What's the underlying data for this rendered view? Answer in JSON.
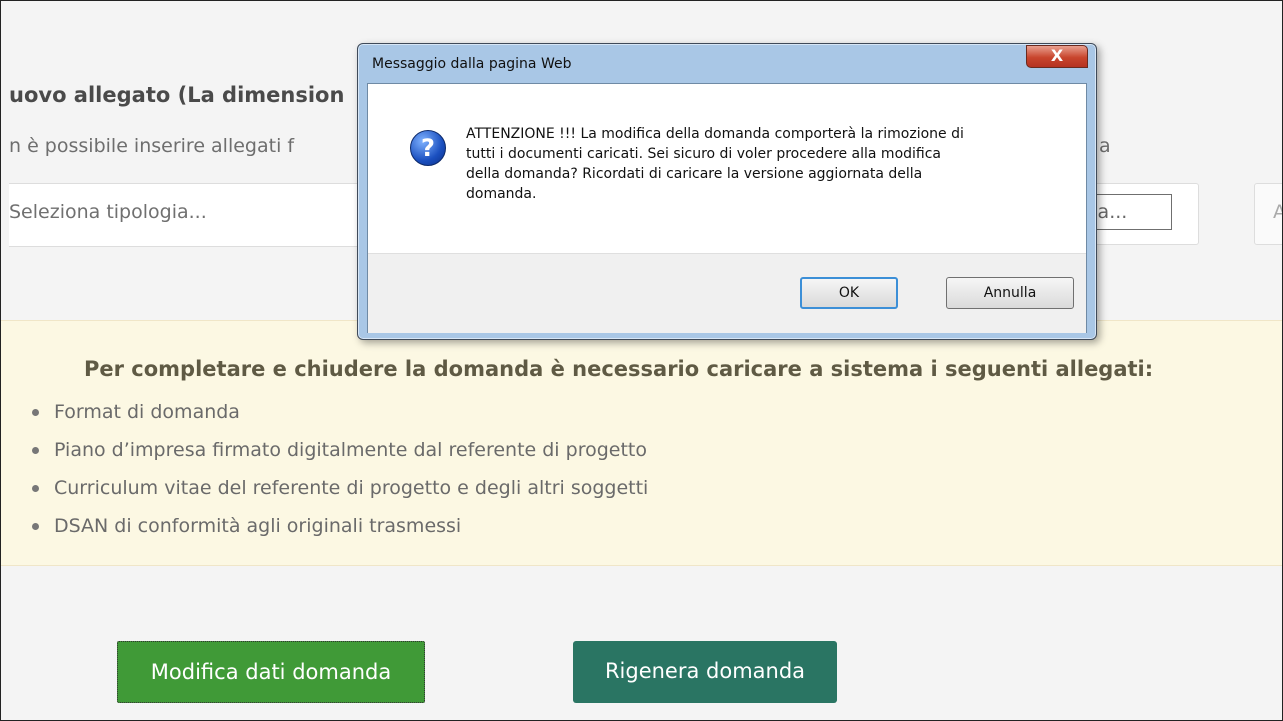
{
  "form": {
    "section_title": "uovo allegato (La dimension",
    "section_note": "n è possibile inserire allegati f",
    "type_select_placeholder": "Seleziona tipologia...",
    "browse_label": "lia...",
    "add_label": "A",
    "partial_right_note": "a"
  },
  "alert": {
    "title": "Per completare e chiudere la domanda è necessario caricare a sistema i seguenti allegati:",
    "items": [
      "Format di domanda",
      "Piano d’impresa firmato digitalmente dal referente di progetto",
      "Curriculum vitae del referente di progetto e degli altri soggetti",
      "DSAN di conformità agli originali trasmessi"
    ]
  },
  "actions": {
    "modifica_label": "Modifica dati domanda",
    "rigenera_label": "Rigenera domanda"
  },
  "dialog": {
    "title": "Messaggio dalla pagina Web",
    "close_label": "X",
    "icon_glyph": "?",
    "message_lines": [
      "ATTENZIONE !!! La modifica della domanda comporterà la rimozione di",
      "tutti i documenti caricati. Sei sicuro di voler procedere alla modifica",
      "della domanda? Ricordati di caricare la versione aggiornata della",
      "domanda."
    ],
    "ok_label": "OK",
    "cancel_label": "Annulla"
  },
  "colors": {
    "primary_green": "#409a37",
    "teal": "#2a7563",
    "alert_bg": "#fcf8e3"
  }
}
